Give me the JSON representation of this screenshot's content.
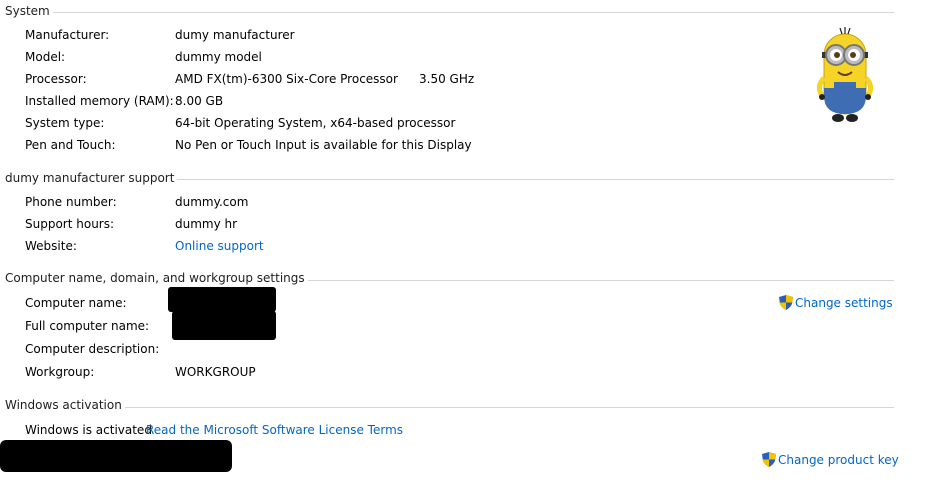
{
  "system": {
    "title": "System",
    "rows": [
      {
        "label": "Manufacturer:",
        "value": "dumy manufacturer"
      },
      {
        "label": "Model:",
        "value": "dummy model"
      },
      {
        "label": "Processor:",
        "value": "AMD FX(tm)-6300 Six-Core Processor",
        "extra": "3.50 GHz"
      },
      {
        "label": "Installed memory (RAM):",
        "value": "8.00 GB"
      },
      {
        "label": "System type:",
        "value": "64-bit Operating System, x64-based processor"
      },
      {
        "label": "Pen and Touch:",
        "value": "No Pen or Touch Input is available for this Display"
      }
    ]
  },
  "support": {
    "title": "dumy manufacturer support",
    "rows": [
      {
        "label": "Phone number:",
        "value": "dummy.com"
      },
      {
        "label": "Support hours:",
        "value": "dummy hr"
      },
      {
        "label": "Website:",
        "value": "Online support"
      }
    ]
  },
  "computer": {
    "title": "Computer name, domain, and workgroup settings",
    "change_settings": "Change settings",
    "rows": [
      {
        "label": "Computer name:",
        "value": ""
      },
      {
        "label": "Full computer name:",
        "value": ""
      },
      {
        "label": "Computer description:",
        "value": ""
      },
      {
        "label": "Workgroup:",
        "value": "WORKGROUP"
      }
    ]
  },
  "activation": {
    "title": "Windows activation",
    "status": "Windows is activated",
    "license_link": "Read the Microsoft Software License Terms",
    "change_key": "Change product key"
  },
  "icons": {
    "oem_logo": "minion-logo",
    "shield": "uac-shield-icon"
  },
  "colors": {
    "link": "#0066cc",
    "separator": "#d6d6d6"
  }
}
